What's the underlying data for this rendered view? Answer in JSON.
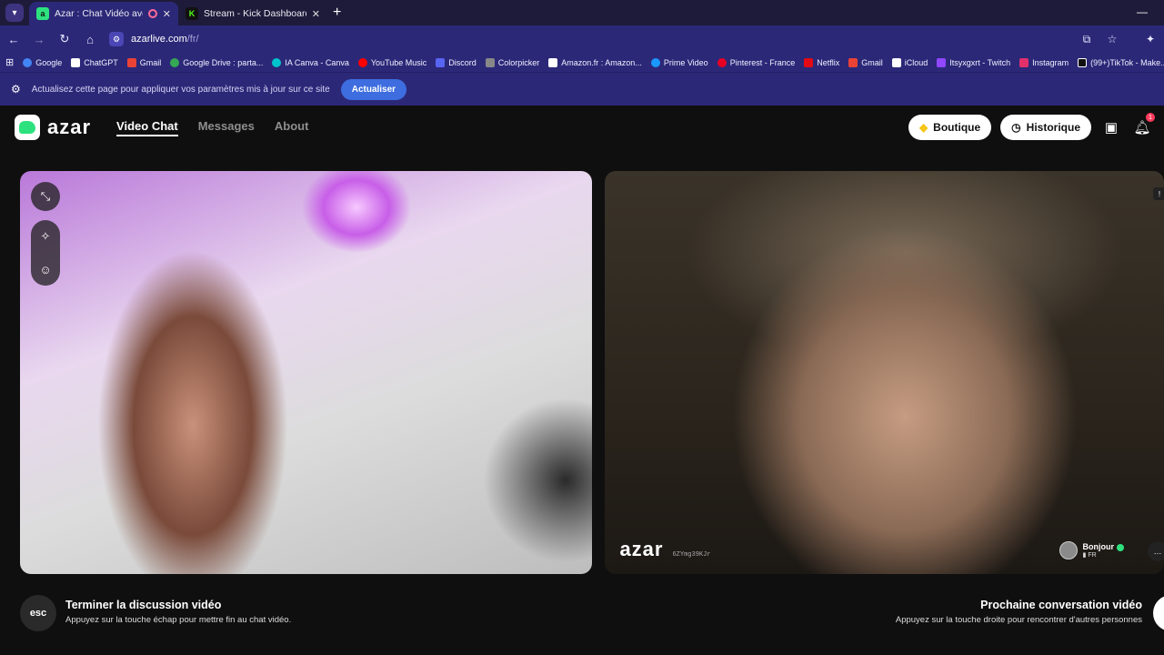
{
  "browser": {
    "tabs": [
      {
        "title": "Azar : Chat Vidéo avec de n",
        "active": true
      },
      {
        "title": "Stream - Kick Dashboard",
        "active": false
      }
    ],
    "new_tab": "+",
    "minimize": "—",
    "url_host": "azarlive.com",
    "url_path": "/fr/",
    "bookmarks": [
      "Google",
      "ChatGPT",
      "Gmail",
      "Google Drive : parta...",
      "IA Canva - Canva",
      "YouTube Music",
      "Discord",
      "Colorpicker",
      "Amazon.fr : Amazon...",
      "Prime Video",
      "Pinterest - France",
      "Netflix",
      "Gmail",
      "iCloud",
      "Itsyxgxrt - Twitch",
      "Instagram",
      "(99+)TikTok - Make..."
    ],
    "infobar_text": "Actualisez cette page pour appliquer vos paramètres mis à jour sur ce site",
    "infobar_button": "Actualiser"
  },
  "app": {
    "logo": "azar",
    "nav": [
      "Video Chat",
      "Messages",
      "About"
    ],
    "boutique": "Boutique",
    "historique": "Historique",
    "notif_count": "1"
  },
  "video": {
    "watermark": "azar",
    "user_id": "6ZYmg39KJr",
    "partner_name": "Bonjour",
    "partner_country": "FR"
  },
  "footer": {
    "esc_label": "esc",
    "end_title": "Terminer la discussion vidéo",
    "end_sub": "Appuyez sur la touche échap pour mettre fin au chat vidéo.",
    "next_title": "Prochaine conversation vidéo",
    "next_sub": "Appuyez sur la touche droite pour rencontrer d'autres personnes"
  },
  "colors": {
    "chrome": "#2c2878",
    "tabbar": "#1e1b3a",
    "brand_green": "#2de27e",
    "infobar_button": "#3d6ddf"
  }
}
